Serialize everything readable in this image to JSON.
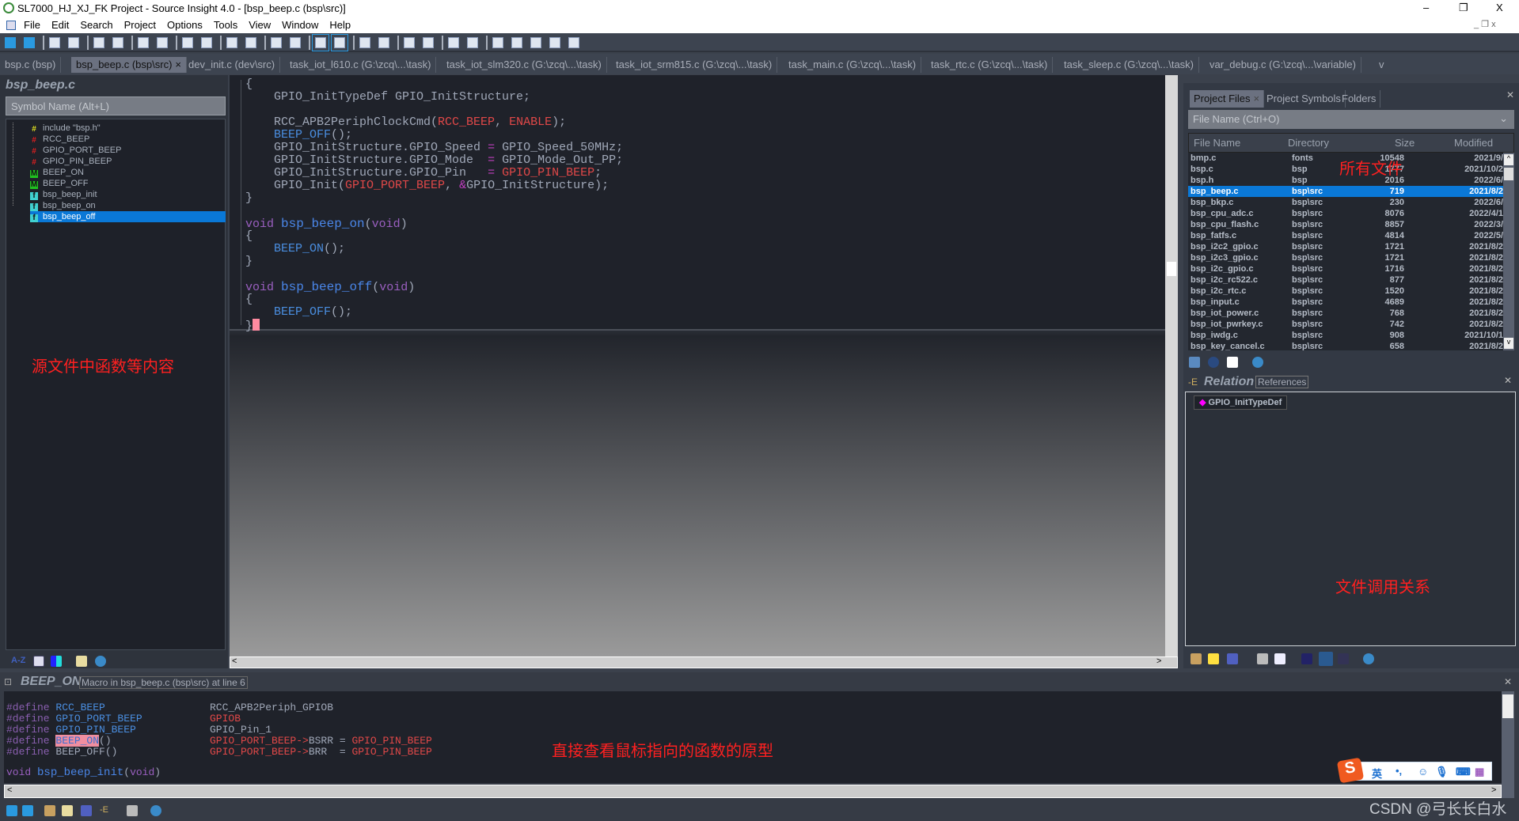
{
  "window": {
    "title": "SL7000_HJ_XJ_FK Project - Source Insight 4.0 - [bsp_beep.c (bsp\\src)]",
    "min": "–",
    "max": "❐",
    "close": "X"
  },
  "menu": [
    "File",
    "Edit",
    "Search",
    "Project",
    "Options",
    "Tools",
    "View",
    "Window",
    "Help"
  ],
  "tabs": [
    {
      "label": "bsp.c (bsp)"
    },
    {
      "label": "bsp_beep.c (bsp\\src)",
      "active": true,
      "close": "×"
    },
    {
      "label": "dev_init.c (dev\\src)"
    },
    {
      "label": "task_iot_l610.c (G:\\zcq\\...\\task)"
    },
    {
      "label": "task_iot_slm320.c (G:\\zcq\\...\\task)"
    },
    {
      "label": "task_iot_srm815.c (G:\\zcq\\...\\task)"
    },
    {
      "label": "task_main.c (G:\\zcq\\...\\task)"
    },
    {
      "label": "task_rtc.c (G:\\zcq\\...\\task)"
    },
    {
      "label": "task_sleep.c (G:\\zcq\\...\\task)"
    },
    {
      "label": "var_debug.c (G:\\zcq\\...\\variable)"
    }
  ],
  "tabs_overflow": "v",
  "symbol_window": {
    "title": "bsp_beep.c",
    "search_placeholder": "Symbol Name (Alt+L)",
    "items": [
      {
        "label": "include \"bsp.h\"",
        "icon": "hash",
        "color": "#e0e020"
      },
      {
        "label": "RCC_BEEP",
        "icon": "hash",
        "color": "#e02020"
      },
      {
        "label": "GPIO_PORT_BEEP",
        "icon": "hash",
        "color": "#e02020"
      },
      {
        "label": "GPIO_PIN_BEEP",
        "icon": "hash",
        "color": "#e02020"
      },
      {
        "label": "BEEP_ON",
        "icon": "M",
        "color": "#20c020"
      },
      {
        "label": "BEEP_OFF",
        "icon": "M",
        "color": "#20c020"
      },
      {
        "label": "bsp_beep_init",
        "icon": "function",
        "color": "#40d0d0"
      },
      {
        "label": "bsp_beep_on",
        "icon": "function",
        "color": "#40d0d0"
      },
      {
        "label": "bsp_beep_off",
        "icon": "function",
        "color": "#40d0d0",
        "selected": true
      }
    ]
  },
  "editor": {
    "lines": [
      [
        [
          "{",
          ""
        ]
      ],
      [
        [
          "    GPIO_InitTypeDef ",
          ""
        ],
        [
          "GPIO_InitStructure;",
          ""
        ]
      ],
      [],
      [
        [
          "    RCC_APB2PeriphClockCmd(",
          ""
        ],
        [
          "RCC_BEEP",
          "red"
        ],
        [
          ", ",
          ""
        ],
        [
          "ENABLE",
          "red"
        ],
        [
          ");",
          ""
        ]
      ],
      [
        [
          "    ",
          ""
        ],
        [
          "BEEP_OFF",
          "blue"
        ],
        [
          "();",
          ""
        ]
      ],
      [
        [
          "    GPIO_InitStructure.GPIO_Speed ",
          ""
        ],
        [
          "=",
          "op"
        ],
        [
          " GPIO_Speed_50MHz;",
          ""
        ]
      ],
      [
        [
          "    GPIO_InitStructure.GPIO_Mode  ",
          ""
        ],
        [
          "=",
          "op"
        ],
        [
          " GPIO_Mode_Out_PP;",
          ""
        ]
      ],
      [
        [
          "    GPIO_InitStructure.GPIO_Pin   ",
          ""
        ],
        [
          "=",
          "op"
        ],
        [
          " ",
          ""
        ],
        [
          "GPIO_PIN_BEEP",
          "red"
        ],
        [
          ";",
          ""
        ]
      ],
      [
        [
          "    GPIO_Init(",
          ""
        ],
        [
          "GPIO_PORT_BEEP",
          "red"
        ],
        [
          ", ",
          ""
        ],
        [
          "&",
          "op"
        ],
        [
          "GPIO_InitStructure);",
          ""
        ]
      ],
      [
        [
          "}",
          ""
        ]
      ],
      [],
      [
        [
          "void",
          "kw"
        ],
        [
          " ",
          ""
        ],
        [
          "bsp_beep_on",
          "fn"
        ],
        [
          "(",
          ""
        ],
        [
          "void",
          "kw"
        ],
        [
          ")",
          ""
        ]
      ],
      [
        [
          "{",
          ""
        ]
      ],
      [
        [
          "    ",
          ""
        ],
        [
          "BEEP_ON",
          "blue"
        ],
        [
          "();",
          ""
        ]
      ],
      [
        [
          "}",
          ""
        ]
      ],
      [],
      [
        [
          "void",
          "kw"
        ],
        [
          " ",
          ""
        ],
        [
          "bsp_beep_off",
          "fn"
        ],
        [
          "(",
          ""
        ],
        [
          "void",
          "kw"
        ],
        [
          ")",
          ""
        ]
      ],
      [
        [
          "{",
          ""
        ]
      ],
      [
        [
          "    ",
          ""
        ],
        [
          "BEEP_OFF",
          "blue"
        ],
        [
          "();",
          ""
        ]
      ],
      [
        [
          "}",
          ""
        ]
      ]
    ]
  },
  "project_window": {
    "tabs": [
      "Project Files",
      "Project Symbols",
      "Folders"
    ],
    "tab_close": "×",
    "filter_placeholder": "File Name (Ctrl+O)",
    "columns": [
      "File Name",
      "Directory",
      "Size",
      "Modified"
    ],
    "files": [
      [
        "bmp.c",
        "fonts",
        "10548",
        "2021/9/"
      ],
      [
        "bsp.c",
        "bsp",
        "1777",
        "2021/10/2"
      ],
      [
        "bsp.h",
        "bsp",
        "2016",
        "2022/6/"
      ],
      [
        "bsp_beep.c",
        "bsp\\src",
        "719",
        "2021/8/2"
      ],
      [
        "bsp_bkp.c",
        "bsp\\src",
        "230",
        "2022/6/"
      ],
      [
        "bsp_cpu_adc.c",
        "bsp\\src",
        "8076",
        "2022/4/1"
      ],
      [
        "bsp_cpu_flash.c",
        "bsp\\src",
        "8857",
        "2022/3/"
      ],
      [
        "bsp_fatfs.c",
        "bsp\\src",
        "4814",
        "2022/5/"
      ],
      [
        "bsp_i2c2_gpio.c",
        "bsp\\src",
        "1721",
        "2021/8/2"
      ],
      [
        "bsp_i2c3_gpio.c",
        "bsp\\src",
        "1721",
        "2021/8/2"
      ],
      [
        "bsp_i2c_gpio.c",
        "bsp\\src",
        "1716",
        "2021/8/2"
      ],
      [
        "bsp_i2c_rc522.c",
        "bsp\\src",
        "877",
        "2021/8/2"
      ],
      [
        "bsp_i2c_rtc.c",
        "bsp\\src",
        "1520",
        "2021/8/2"
      ],
      [
        "bsp_input.c",
        "bsp\\src",
        "4689",
        "2021/8/2"
      ],
      [
        "bsp_iot_power.c",
        "bsp\\src",
        "768",
        "2021/8/2"
      ],
      [
        "bsp_iot_pwrkey.c",
        "bsp\\src",
        "742",
        "2021/8/2"
      ],
      [
        "bsp_iwdg.c",
        "bsp\\src",
        "908",
        "2021/10/1"
      ],
      [
        "bsp_key_cancel.c",
        "bsp\\src",
        "658",
        "2021/8/2"
      ]
    ],
    "selected_file": "bsp_beep.c"
  },
  "relation_window": {
    "title": "Relation",
    "mode": "References",
    "item": "GPIO_InitTypeDef",
    "item_color": "#ff00ff"
  },
  "context_window": {
    "symbol": "BEEP_ON",
    "description": "Macro in bsp_beep.c (bsp\\src) at line 6",
    "lines": [
      {
        "def": "#define ",
        "name": "RCC_BEEP",
        "nameColor": "blue",
        "val": [
          [
            "RCC_APB2Periph_GPIOB",
            ""
          ]
        ]
      },
      {
        "def": "#define ",
        "name": "GPIO_PORT_BEEP",
        "nameColor": "blue",
        "val": [
          [
            "GPIOB",
            "red"
          ]
        ]
      },
      {
        "def": "#define ",
        "name": "GPIO_PIN_BEEP",
        "nameColor": "blue",
        "val": [
          [
            "GPIO_Pin_1",
            ""
          ]
        ]
      },
      {
        "def": "#define ",
        "name": "BEEP_ON",
        "nameColor": "hl",
        "suffix": "()",
        "val": [
          [
            "GPIO_PORT_BEEP->",
            "red"
          ],
          [
            "BSRR = ",
            ""
          ],
          [
            "GPIO_PIN_BEEP",
            "red"
          ]
        ]
      },
      {
        "def": "#define ",
        "name": "BEEP_OFF",
        "nameColor": "",
        "suffix": "()",
        "val": [
          [
            "GPIO_PORT_BEEP->",
            "red"
          ],
          [
            "BRR  = ",
            ""
          ],
          [
            "GPIO_PIN_BEEP",
            "red"
          ]
        ]
      }
    ],
    "func_line": {
      "kw": "void",
      "name": "bsp_beep_init",
      "args": "void"
    }
  },
  "annotations": {
    "symbols": "源文件中函数等内容",
    "files": "所有文件",
    "relation": "文件调用关系",
    "context": "直接查看鼠标指向的函数的原型"
  },
  "ime": {
    "lang": "英",
    "punct": "•,"
  },
  "watermark": "CSDN @弓长长白水",
  "colors": {
    "accent": "#0a78d7",
    "annotation": "#ff2020",
    "panel": "#333944",
    "editor_bg": "#1f222a"
  }
}
